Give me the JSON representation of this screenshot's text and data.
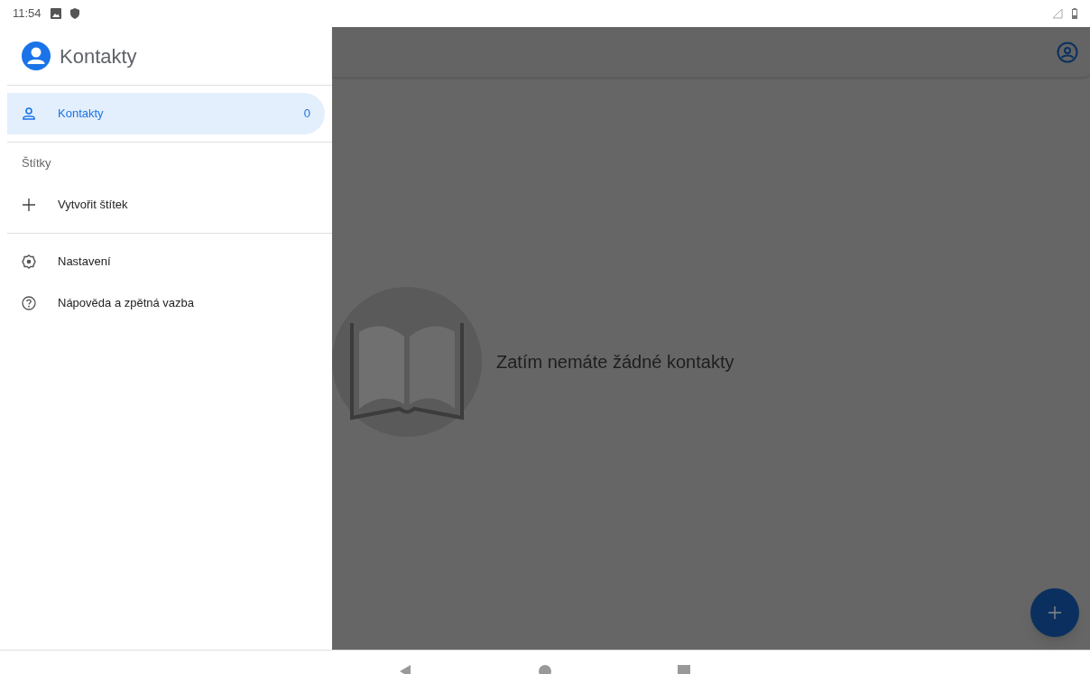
{
  "status_bar": {
    "time": "11:54"
  },
  "drawer": {
    "title": "Kontakty",
    "items": [
      {
        "kind": "contacts",
        "label": "Kontakty",
        "count": "0",
        "selected": true
      }
    ],
    "labels_heading": "Štítky",
    "create_label": "Vytvořit štítek",
    "footer_items": [
      {
        "kind": "settings",
        "label": "Nastavení"
      },
      {
        "kind": "help",
        "label": "Nápověda a zpětná vazba"
      }
    ]
  },
  "main": {
    "empty_message": "Zatím nemáte žádné kontakty"
  }
}
